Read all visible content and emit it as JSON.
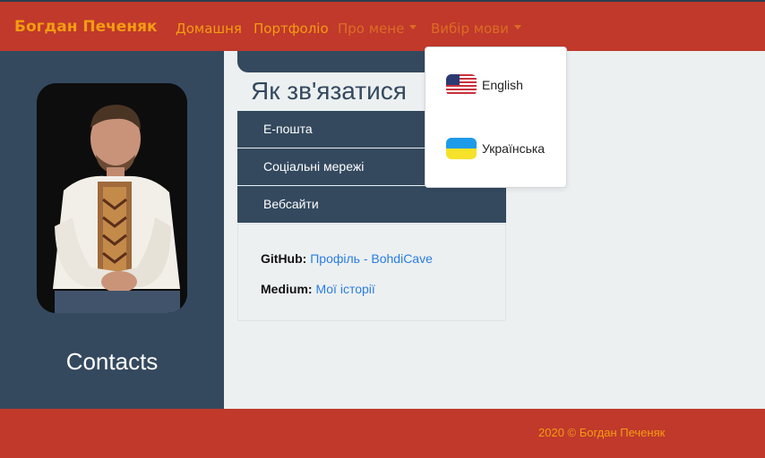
{
  "navbar": {
    "brand": "Богдан Печеняк",
    "links": [
      "Домашня",
      "Портфоліо",
      "Про мене",
      "Вибір мови"
    ]
  },
  "sidebar": {
    "title": "Contacts"
  },
  "main": {
    "section_title": "Як зв'язатися",
    "accordion": [
      {
        "label": "Е-пошта"
      },
      {
        "label": "Соціальні мережі"
      },
      {
        "label": "Вебсайти"
      }
    ],
    "websites": [
      {
        "label": "GitHub:",
        "link": "Профіль - BohdiCave"
      },
      {
        "label": "Medium:",
        "link": "Мої історії"
      }
    ]
  },
  "language_dropdown": {
    "items": [
      {
        "label": "English",
        "flag": "us-flag-icon"
      },
      {
        "label": "Українська",
        "flag": "ukraine-flag-icon"
      }
    ]
  },
  "footer": {
    "text": "2020 © Богдан Печеняк"
  },
  "colors": {
    "navbar": "#c0392b",
    "brand": "#f39c12",
    "sidebar": "#34495e",
    "background": "#ecf0f1",
    "link": "#2a7de1"
  }
}
